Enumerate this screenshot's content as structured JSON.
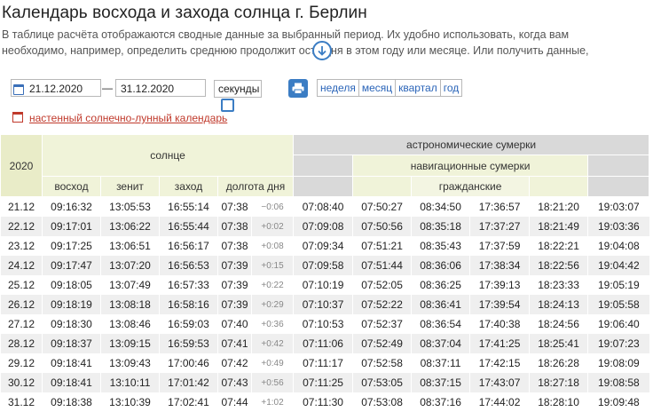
{
  "page": {
    "title": "Календарь восхода и захода солнца г. Берлин",
    "description_line1": "В таблице расчёта отображаются сводные данные за выбранный период. Их удобно использовать, когда вам",
    "description_line2": "необходимо, например, определить среднюю продолжит   ость дня в этом году или месяце. Или получить данные,"
  },
  "toolbar": {
    "date_from": "21.12.2020",
    "date_separator": "—",
    "date_to": "31.12.2020",
    "seconds_label": "секунды",
    "seconds_checked": false,
    "periods": [
      "неделя",
      "месяц",
      "квартал",
      "год"
    ]
  },
  "lunar_link": "настенный солнечно-лунный календарь",
  "table": {
    "year": "2020",
    "group_sun": "солнце",
    "group_astro": "астрономические сумерки",
    "group_nav": "навигационные сумерки",
    "group_civil": "гражданские",
    "col_sunrise": "восход",
    "col_zenith": "зенит",
    "col_sunset": "заход",
    "col_daylength": "долгота дня",
    "rows": [
      {
        "date": "21.12",
        "sunrise": "09:16:32",
        "zenith": "13:05:53",
        "sunset": "16:55:14",
        "length": "07:38",
        "delta": "−0:06",
        "a1": "07:08:40",
        "n1": "07:50:27",
        "c1": "08:34:50",
        "c2": "17:36:57",
        "n2": "18:21:20",
        "a2": "19:03:07"
      },
      {
        "date": "22.12",
        "sunrise": "09:17:01",
        "zenith": "13:06:22",
        "sunset": "16:55:44",
        "length": "07:38",
        "delta": "+0:02",
        "a1": "07:09:08",
        "n1": "07:50:56",
        "c1": "08:35:18",
        "c2": "17:37:27",
        "n2": "18:21:49",
        "a2": "19:03:36"
      },
      {
        "date": "23.12",
        "sunrise": "09:17:25",
        "zenith": "13:06:51",
        "sunset": "16:56:17",
        "length": "07:38",
        "delta": "+0:08",
        "a1": "07:09:34",
        "n1": "07:51:21",
        "c1": "08:35:43",
        "c2": "17:37:59",
        "n2": "18:22:21",
        "a2": "19:04:08"
      },
      {
        "date": "24.12",
        "sunrise": "09:17:47",
        "zenith": "13:07:20",
        "sunset": "16:56:53",
        "length": "07:39",
        "delta": "+0:15",
        "a1": "07:09:58",
        "n1": "07:51:44",
        "c1": "08:36:06",
        "c2": "17:38:34",
        "n2": "18:22:56",
        "a2": "19:04:42"
      },
      {
        "date": "25.12",
        "sunrise": "09:18:05",
        "zenith": "13:07:49",
        "sunset": "16:57:33",
        "length": "07:39",
        "delta": "+0:22",
        "a1": "07:10:19",
        "n1": "07:52:05",
        "c1": "08:36:25",
        "c2": "17:39:13",
        "n2": "18:23:33",
        "a2": "19:05:19"
      },
      {
        "date": "26.12",
        "sunrise": "09:18:19",
        "zenith": "13:08:18",
        "sunset": "16:58:16",
        "length": "07:39",
        "delta": "+0:29",
        "a1": "07:10:37",
        "n1": "07:52:22",
        "c1": "08:36:41",
        "c2": "17:39:54",
        "n2": "18:24:13",
        "a2": "19:05:58"
      },
      {
        "date": "27.12",
        "sunrise": "09:18:30",
        "zenith": "13:08:46",
        "sunset": "16:59:03",
        "length": "07:40",
        "delta": "+0:36",
        "a1": "07:10:53",
        "n1": "07:52:37",
        "c1": "08:36:54",
        "c2": "17:40:38",
        "n2": "18:24:56",
        "a2": "19:06:40"
      },
      {
        "date": "28.12",
        "sunrise": "09:18:37",
        "zenith": "13:09:15",
        "sunset": "16:59:53",
        "length": "07:41",
        "delta": "+0:42",
        "a1": "07:11:06",
        "n1": "07:52:49",
        "c1": "08:37:04",
        "c2": "17:41:25",
        "n2": "18:25:41",
        "a2": "19:07:23"
      },
      {
        "date": "29.12",
        "sunrise": "09:18:41",
        "zenith": "13:09:43",
        "sunset": "17:00:46",
        "length": "07:42",
        "delta": "+0:49",
        "a1": "07:11:17",
        "n1": "07:52:58",
        "c1": "08:37:11",
        "c2": "17:42:15",
        "n2": "18:26:28",
        "a2": "19:08:09"
      },
      {
        "date": "30.12",
        "sunrise": "09:18:41",
        "zenith": "13:10:11",
        "sunset": "17:01:42",
        "length": "07:43",
        "delta": "+0:56",
        "a1": "07:11:25",
        "n1": "07:53:05",
        "c1": "08:37:15",
        "c2": "17:43:07",
        "n2": "18:27:18",
        "a2": "19:08:58"
      },
      {
        "date": "31.12",
        "sunrise": "09:18:38",
        "zenith": "13:10:39",
        "sunset": "17:02:41",
        "length": "07:44",
        "delta": "+1:02",
        "a1": "07:11:30",
        "n1": "07:53:08",
        "c1": "08:37:16",
        "c2": "17:44:02",
        "n2": "18:28:10",
        "a2": "19:09:48"
      }
    ]
  },
  "colors": {
    "accent": "#3b7dc4",
    "link_red": "#c0392b",
    "header_green": "#f0f3d9",
    "header_gray": "#d9d9d9",
    "row_alt": "#efefef"
  },
  "icons": {
    "scroll_down": "arrow-down-icon",
    "date": "calendar-icon",
    "print": "printer-icon",
    "lunar": "red-calendar-icon"
  }
}
